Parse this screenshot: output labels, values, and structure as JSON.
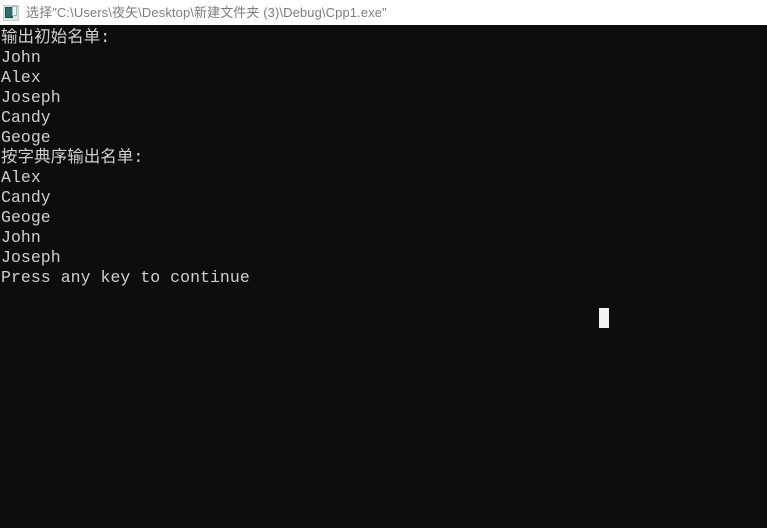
{
  "window": {
    "title": "选择\"C:\\Users\\夜矢\\Desktop\\新建文件夹 (3)\\Debug\\Cpp1.exe\"",
    "icon": "console-app-icon",
    "background_color": "#0d0d0d",
    "titlebar_color": "#ffffff",
    "title_color": "#7c7c80"
  },
  "console": {
    "foreground_color": "#cfcfcf",
    "background_color": "#0d0d0d",
    "caret": {
      "name": "block-cursor",
      "color": "#f2f2f2",
      "column": 60,
      "row": 14
    },
    "lines": [
      "输出初始名单:",
      "John",
      "Alex",
      "Joseph",
      "Candy",
      "Geoge",
      "按字典序输出名单:",
      "Alex",
      "Candy",
      "Geoge",
      "John",
      "Joseph",
      "Press any key to continue"
    ],
    "sections": [
      {
        "heading": "输出初始名单:",
        "names": [
          "John",
          "Alex",
          "Joseph",
          "Candy",
          "Geoge"
        ]
      },
      {
        "heading": "按字典序输出名单:",
        "names": [
          "Alex",
          "Candy",
          "Geoge",
          "John",
          "Joseph"
        ]
      }
    ],
    "prompt": "Press any key to continue"
  }
}
